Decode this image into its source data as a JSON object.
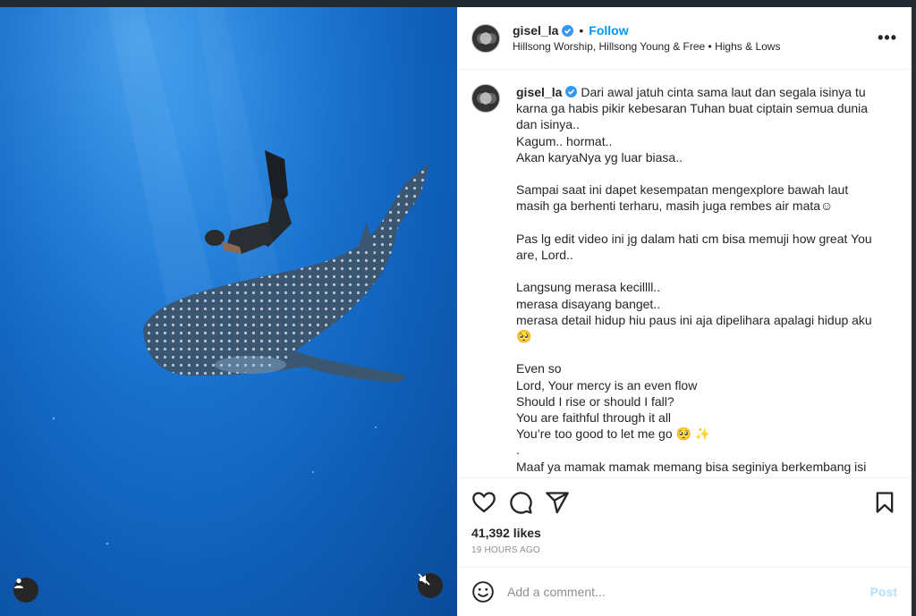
{
  "post": {
    "username": "gisel_la",
    "follow_label": "Follow",
    "dot": "•",
    "audio": "Hillsong Worship, Hillsong Young & Free • Highs & Lows",
    "more": "•••"
  },
  "caption": {
    "username": "gisel_la",
    "text": "Dari awal jatuh cinta sama laut dan segala isinya tu karna ga habis pikir kebesaran Tuhan buat ciptain semua dunia dan isinya..\nKagum.. hormat..\nAkan karyaNya yg luar biasa..\n\nSampai saat ini dapet kesempatan mengexplore bawah laut masih ga berhenti terharu, masih juga rembes air mata☺︎\n\nPas lg edit video ini jg dalam hati cm bisa memuji how great You are, Lord..\n\nLangsung merasa kecillll..\nmerasa disayang banget..\nmerasa detail hidup hiu paus ini aja dipelihara apalagi hidup aku 🥺\n\nEven so\nLord, Your mercy is an even flow\nShould I rise or should I fall?\nYou are faithful through it all\nYou’re too good to let me go 🥺 ✨\n.\nMaaf ya mamak mamak memang bisa seginiya berkembang isi"
  },
  "stats": {
    "likes": "41,392 likes",
    "time": "19 HOURS AGO"
  },
  "comment_box": {
    "placeholder": "Add a comment...",
    "post_label": "Post"
  },
  "icons": {
    "verified": "verified-badge-icon",
    "like": "heart-icon",
    "comment": "comment-icon",
    "share": "share-icon",
    "save": "bookmark-icon",
    "emoji": "emoji-icon",
    "user_tag": "user-icon",
    "mute": "muted-speaker-icon",
    "more": "more-options-icon"
  },
  "colors": {
    "accent": "#0095f6",
    "post_disabled": "#b2dffc",
    "ocean": "#1a73cf"
  }
}
